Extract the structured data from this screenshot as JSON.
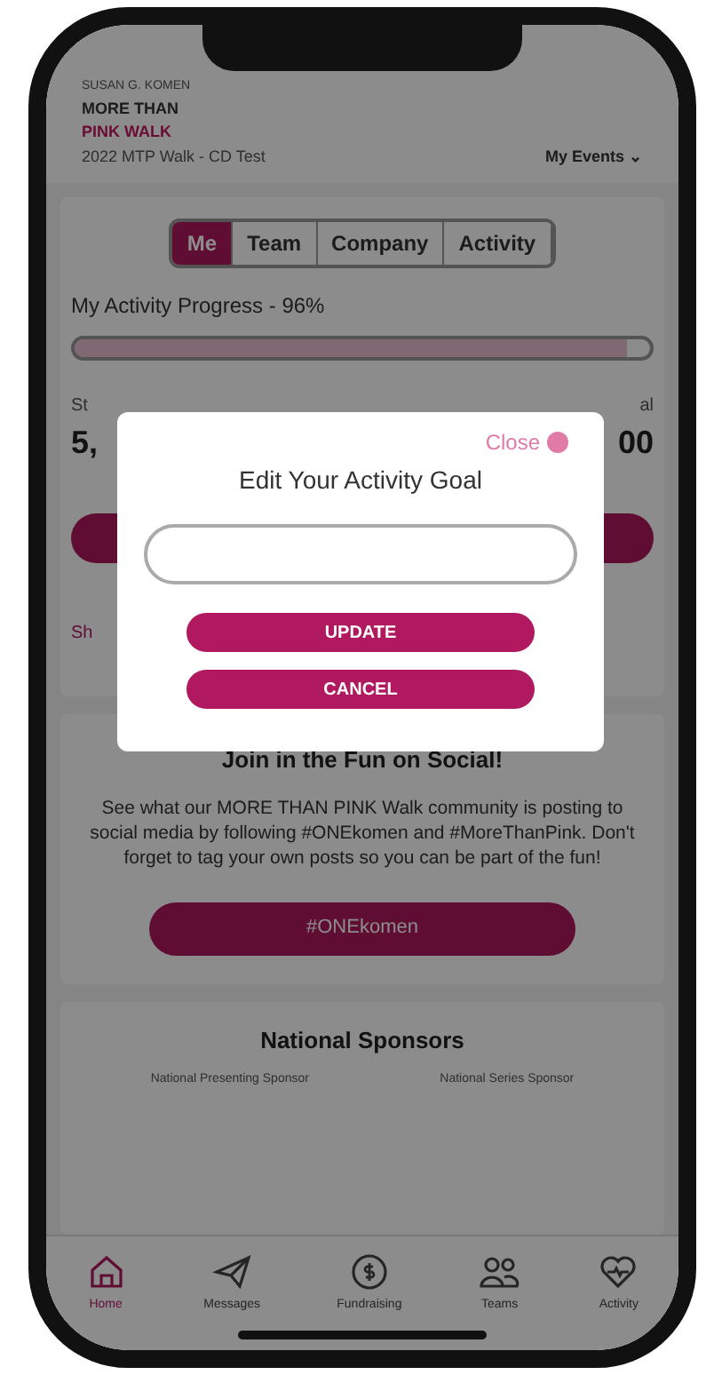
{
  "header": {
    "logo_lines": [
      "SUSAN G. KOMEN",
      "MORE THAN",
      "PINK WALK"
    ],
    "event_name": "2022 MTP Walk - CD Test",
    "events_menu": "My Events ⌄"
  },
  "tabs": [
    {
      "label": "Me",
      "selected": true
    },
    {
      "label": "Team",
      "selected": false
    },
    {
      "label": "Company",
      "selected": false
    },
    {
      "label": "Activity",
      "selected": false
    }
  ],
  "progress": {
    "label": "My Activity Progress - 96%",
    "level": 0.96
  },
  "stats": {
    "left_label": "St",
    "left_value": "5,",
    "right_label": "al",
    "right_value": "00",
    "link": "Sh"
  },
  "modal": {
    "close": "Close",
    "title": "Edit Your Activity Goal",
    "buttons": [
      "UPDATE",
      "CANCEL"
    ]
  },
  "social": {
    "title": "Join in the Fun on Social!",
    "text": "See what our MORE THAN PINK Walk community is posting to social media by following #ONEkomen and #MoreThanPink. Don't forget to tag your own posts so you can be part of the fun!",
    "button": "#ONEkomen"
  },
  "sponsors": {
    "title": "National Sponsors",
    "labels": [
      "National Presenting Sponsor",
      "National Series Sponsor"
    ]
  },
  "nav": [
    {
      "kind": "home",
      "label": "Home",
      "selected": true
    },
    {
      "kind": "plane",
      "label": "Messages",
      "selected": false
    },
    {
      "kind": "dollar",
      "label": "Fundraising",
      "selected": false
    },
    {
      "kind": "people",
      "label": "Teams",
      "selected": false
    },
    {
      "kind": "heart",
      "label": "Activity",
      "selected": false
    }
  ]
}
